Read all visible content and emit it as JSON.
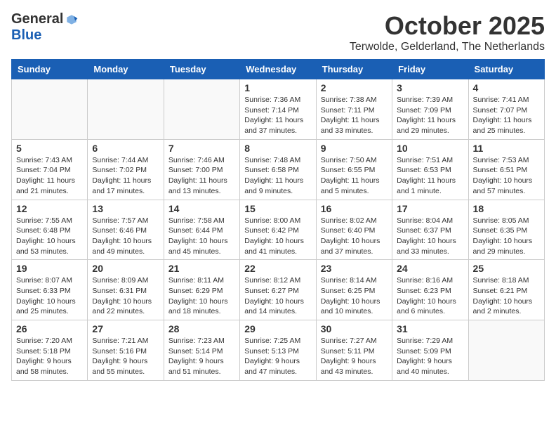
{
  "logo": {
    "general": "General",
    "blue": "Blue"
  },
  "title": "October 2025",
  "location": "Terwolde, Gelderland, The Netherlands",
  "days_of_week": [
    "Sunday",
    "Monday",
    "Tuesday",
    "Wednesday",
    "Thursday",
    "Friday",
    "Saturday"
  ],
  "weeks": [
    [
      {
        "day": "",
        "info": ""
      },
      {
        "day": "",
        "info": ""
      },
      {
        "day": "",
        "info": ""
      },
      {
        "day": "1",
        "info": "Sunrise: 7:36 AM\nSunset: 7:14 PM\nDaylight: 11 hours\nand 37 minutes."
      },
      {
        "day": "2",
        "info": "Sunrise: 7:38 AM\nSunset: 7:11 PM\nDaylight: 11 hours\nand 33 minutes."
      },
      {
        "day": "3",
        "info": "Sunrise: 7:39 AM\nSunset: 7:09 PM\nDaylight: 11 hours\nand 29 minutes."
      },
      {
        "day": "4",
        "info": "Sunrise: 7:41 AM\nSunset: 7:07 PM\nDaylight: 11 hours\nand 25 minutes."
      }
    ],
    [
      {
        "day": "5",
        "info": "Sunrise: 7:43 AM\nSunset: 7:04 PM\nDaylight: 11 hours\nand 21 minutes."
      },
      {
        "day": "6",
        "info": "Sunrise: 7:44 AM\nSunset: 7:02 PM\nDaylight: 11 hours\nand 17 minutes."
      },
      {
        "day": "7",
        "info": "Sunrise: 7:46 AM\nSunset: 7:00 PM\nDaylight: 11 hours\nand 13 minutes."
      },
      {
        "day": "8",
        "info": "Sunrise: 7:48 AM\nSunset: 6:58 PM\nDaylight: 11 hours\nand 9 minutes."
      },
      {
        "day": "9",
        "info": "Sunrise: 7:50 AM\nSunset: 6:55 PM\nDaylight: 11 hours\nand 5 minutes."
      },
      {
        "day": "10",
        "info": "Sunrise: 7:51 AM\nSunset: 6:53 PM\nDaylight: 11 hours\nand 1 minute."
      },
      {
        "day": "11",
        "info": "Sunrise: 7:53 AM\nSunset: 6:51 PM\nDaylight: 10 hours\nand 57 minutes."
      }
    ],
    [
      {
        "day": "12",
        "info": "Sunrise: 7:55 AM\nSunset: 6:48 PM\nDaylight: 10 hours\nand 53 minutes."
      },
      {
        "day": "13",
        "info": "Sunrise: 7:57 AM\nSunset: 6:46 PM\nDaylight: 10 hours\nand 49 minutes."
      },
      {
        "day": "14",
        "info": "Sunrise: 7:58 AM\nSunset: 6:44 PM\nDaylight: 10 hours\nand 45 minutes."
      },
      {
        "day": "15",
        "info": "Sunrise: 8:00 AM\nSunset: 6:42 PM\nDaylight: 10 hours\nand 41 minutes."
      },
      {
        "day": "16",
        "info": "Sunrise: 8:02 AM\nSunset: 6:40 PM\nDaylight: 10 hours\nand 37 minutes."
      },
      {
        "day": "17",
        "info": "Sunrise: 8:04 AM\nSunset: 6:37 PM\nDaylight: 10 hours\nand 33 minutes."
      },
      {
        "day": "18",
        "info": "Sunrise: 8:05 AM\nSunset: 6:35 PM\nDaylight: 10 hours\nand 29 minutes."
      }
    ],
    [
      {
        "day": "19",
        "info": "Sunrise: 8:07 AM\nSunset: 6:33 PM\nDaylight: 10 hours\nand 25 minutes."
      },
      {
        "day": "20",
        "info": "Sunrise: 8:09 AM\nSunset: 6:31 PM\nDaylight: 10 hours\nand 22 minutes."
      },
      {
        "day": "21",
        "info": "Sunrise: 8:11 AM\nSunset: 6:29 PM\nDaylight: 10 hours\nand 18 minutes."
      },
      {
        "day": "22",
        "info": "Sunrise: 8:12 AM\nSunset: 6:27 PM\nDaylight: 10 hours\nand 14 minutes."
      },
      {
        "day": "23",
        "info": "Sunrise: 8:14 AM\nSunset: 6:25 PM\nDaylight: 10 hours\nand 10 minutes."
      },
      {
        "day": "24",
        "info": "Sunrise: 8:16 AM\nSunset: 6:23 PM\nDaylight: 10 hours\nand 6 minutes."
      },
      {
        "day": "25",
        "info": "Sunrise: 8:18 AM\nSunset: 6:21 PM\nDaylight: 10 hours\nand 2 minutes."
      }
    ],
    [
      {
        "day": "26",
        "info": "Sunrise: 7:20 AM\nSunset: 5:18 PM\nDaylight: 9 hours\nand 58 minutes."
      },
      {
        "day": "27",
        "info": "Sunrise: 7:21 AM\nSunset: 5:16 PM\nDaylight: 9 hours\nand 55 minutes."
      },
      {
        "day": "28",
        "info": "Sunrise: 7:23 AM\nSunset: 5:14 PM\nDaylight: 9 hours\nand 51 minutes."
      },
      {
        "day": "29",
        "info": "Sunrise: 7:25 AM\nSunset: 5:13 PM\nDaylight: 9 hours\nand 47 minutes."
      },
      {
        "day": "30",
        "info": "Sunrise: 7:27 AM\nSunset: 5:11 PM\nDaylight: 9 hours\nand 43 minutes."
      },
      {
        "day": "31",
        "info": "Sunrise: 7:29 AM\nSunset: 5:09 PM\nDaylight: 9 hours\nand 40 minutes."
      },
      {
        "day": "",
        "info": ""
      }
    ]
  ]
}
